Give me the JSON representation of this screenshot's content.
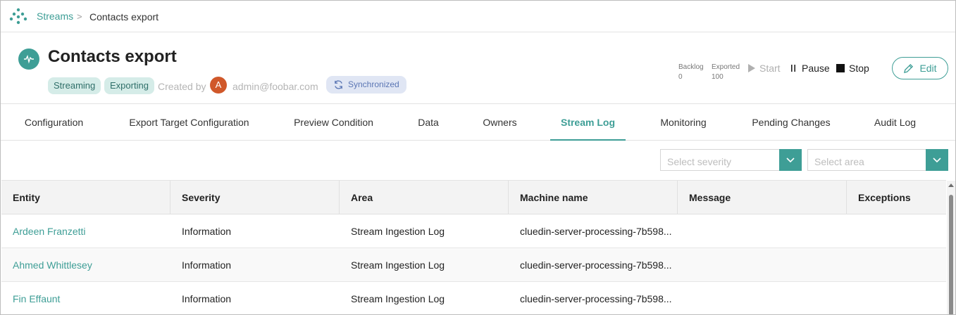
{
  "breadcrumb": {
    "root": "Streams",
    "separator": ">",
    "current": "Contacts export"
  },
  "header": {
    "title": "Contacts export",
    "tags": [
      "Streaming",
      "Exporting"
    ],
    "created_label": "Created by",
    "avatar_initial": "A",
    "created_by": "admin@foobar.com",
    "sync_status": "Synchronized"
  },
  "stats": {
    "backlog_label": "Backlog",
    "backlog_value": "0",
    "exported_label": "Exported",
    "exported_value": "100"
  },
  "actions": {
    "start": "Start",
    "pause": "Pause",
    "stop": "Stop",
    "edit": "Edit"
  },
  "tabs": [
    {
      "label": "Configuration"
    },
    {
      "label": "Export Target Configuration"
    },
    {
      "label": "Preview Condition"
    },
    {
      "label": "Data"
    },
    {
      "label": "Owners"
    },
    {
      "label": "Stream Log"
    },
    {
      "label": "Monitoring"
    },
    {
      "label": "Pending Changes"
    },
    {
      "label": "Audit Log"
    }
  ],
  "filters": {
    "severity_placeholder": "Select severity",
    "area_placeholder": "Select area"
  },
  "table": {
    "columns": [
      "Entity",
      "Severity",
      "Area",
      "Machine name",
      "Message",
      "Exceptions"
    ],
    "rows": [
      {
        "entity": "Ardeen Franzetti",
        "severity": "Information",
        "area": "Stream Ingestion Log",
        "machine": "cluedin-server-processing-7b598...",
        "message": "",
        "exceptions": ""
      },
      {
        "entity": "Ahmed Whittlesey",
        "severity": "Information",
        "area": "Stream Ingestion Log",
        "machine": "cluedin-server-processing-7b598...",
        "message": "",
        "exceptions": ""
      },
      {
        "entity": "Fin Effaunt",
        "severity": "Information",
        "area": "Stream Ingestion Log",
        "machine": "cluedin-server-processing-7b598...",
        "message": "",
        "exceptions": ""
      }
    ]
  },
  "colors": {
    "accent": "#3e9e96",
    "avatar": "#d0582a",
    "sync_bg": "#e0e6f4"
  }
}
